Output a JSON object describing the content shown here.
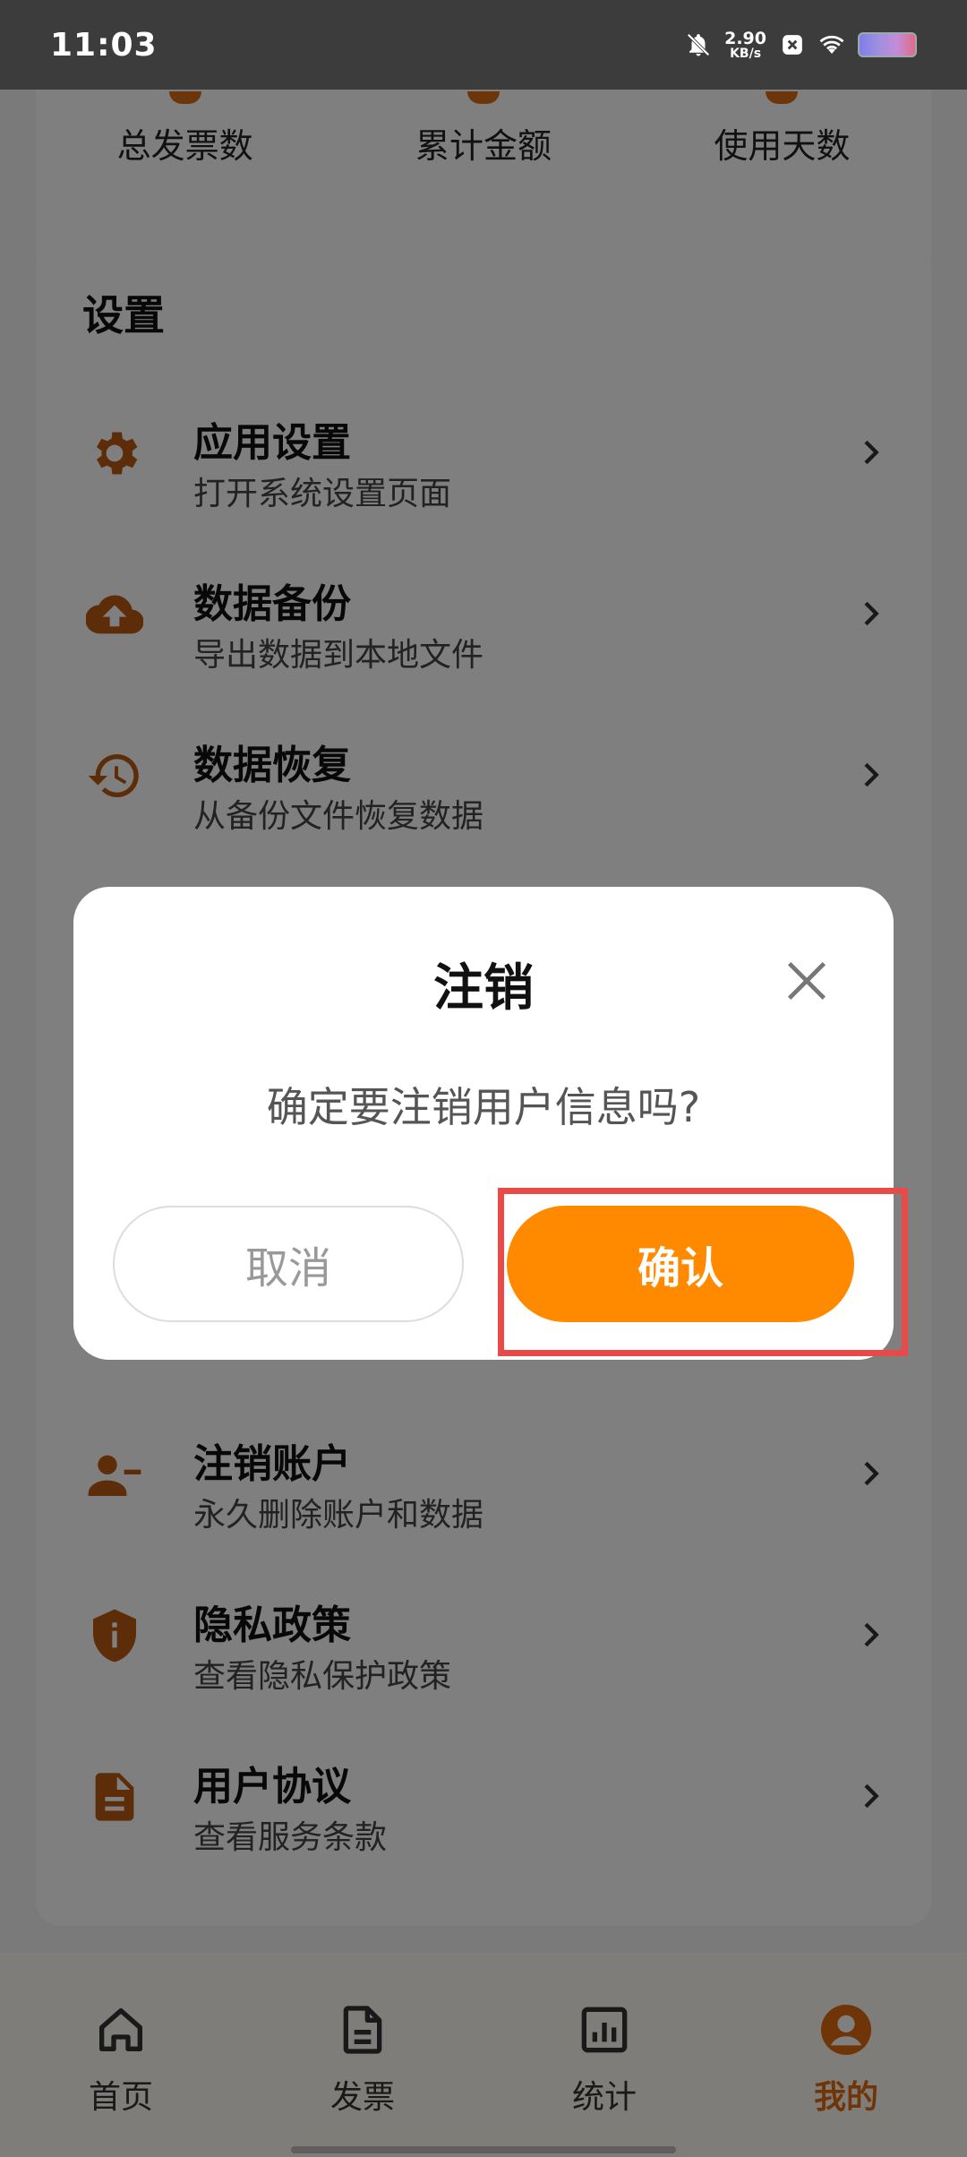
{
  "status_bar": {
    "time": "11:03",
    "net_speed_value": "2.90",
    "net_speed_unit": "KB/s",
    "icons": [
      "bell-muted-icon",
      "x-icon",
      "wifi-icon",
      "battery-icon"
    ]
  },
  "stats": {
    "labels": [
      "总发票数",
      "累计金额",
      "使用天数"
    ]
  },
  "settings": {
    "title": "设置",
    "items": [
      {
        "title": "应用设置",
        "subtitle": "打开系统设置页面",
        "icon": "gear-icon"
      },
      {
        "title": "数据备份",
        "subtitle": "导出数据到本地文件",
        "icon": "cloud-upload-icon"
      },
      {
        "title": "数据恢复",
        "subtitle": "从备份文件恢复数据",
        "icon": "history-icon"
      },
      {
        "title": "注销账户",
        "subtitle": "永久删除账户和数据",
        "icon": "user-remove-icon"
      },
      {
        "title": "隐私政策",
        "subtitle": "查看隐私保护政策",
        "icon": "shield-info-icon"
      },
      {
        "title": "用户协议",
        "subtitle": "查看服务条款",
        "icon": "document-icon"
      }
    ]
  },
  "dialog": {
    "title": "注销",
    "message": "确定要注销用户信息吗?",
    "cancel_label": "取消",
    "confirm_label": "确认"
  },
  "bottom_nav": {
    "items": [
      {
        "label": "首页",
        "icon": "home-icon"
      },
      {
        "label": "发票",
        "icon": "invoice-icon"
      },
      {
        "label": "统计",
        "icon": "chart-icon"
      },
      {
        "label": "我的",
        "icon": "user-circle-icon",
        "active": true
      }
    ]
  },
  "colors": {
    "accent": "#ff8a00",
    "icon_brown": "#b85a10",
    "highlight": "#e84a4a"
  }
}
